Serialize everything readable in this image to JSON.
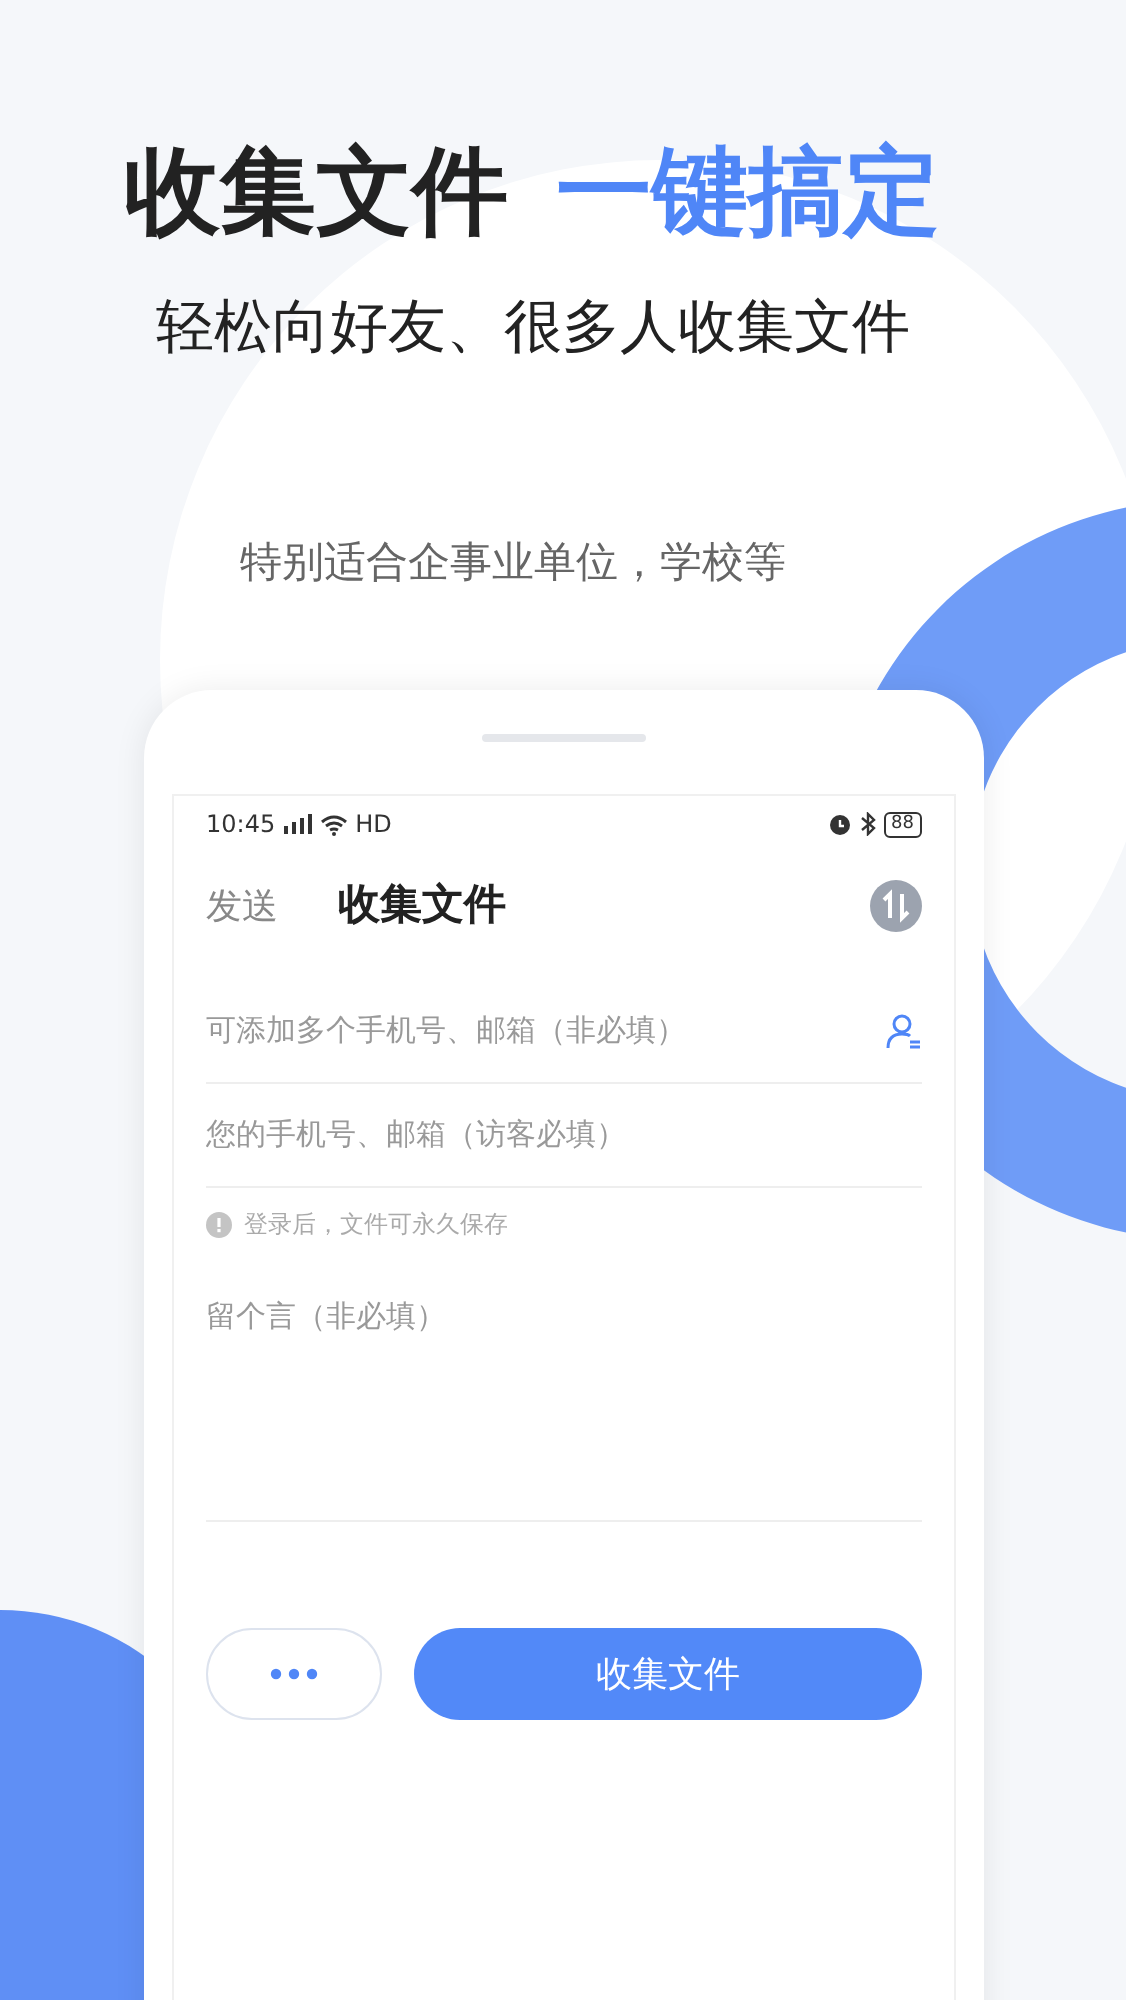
{
  "headline": {
    "title": "收集文件",
    "highlight": "一键搞定"
  },
  "subtitle": "轻松向好友、很多人收集文件",
  "tagline": "特别适合企事业单位，学校等",
  "phone": {
    "status_bar": {
      "time": "10:45",
      "network": "HD",
      "battery": "88"
    },
    "header": {
      "tab": "发送",
      "title": "收集文件"
    },
    "fields": [
      {
        "kind": "contacts",
        "placeholder": "可添加多个手机号、邮箱（非必填）"
      },
      {
        "kind": "plain",
        "placeholder": "您的手机号、邮箱（访客必填）"
      }
    ],
    "notice": "登录后，文件可永久保存",
    "message": {
      "placeholder": "留个言（非必填）"
    },
    "submit_button": "收集文件"
  }
}
